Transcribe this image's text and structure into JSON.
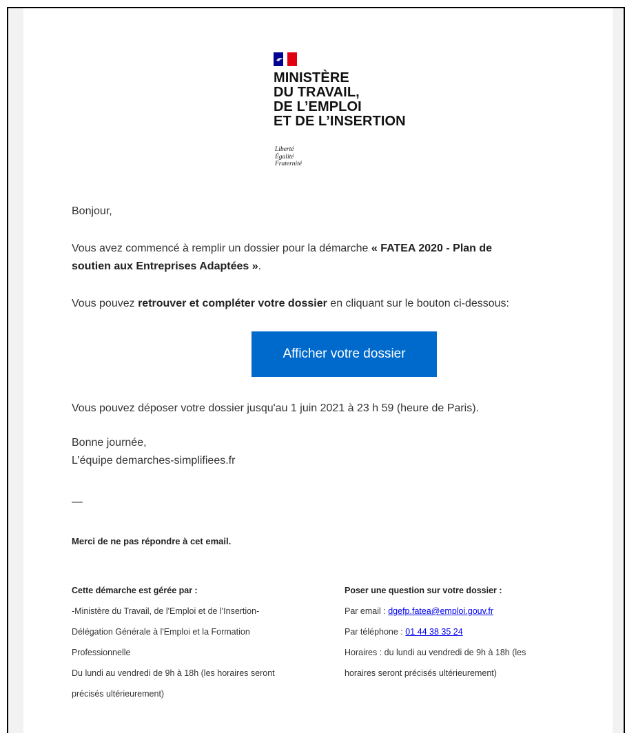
{
  "logo": {
    "ministry_lines": [
      "MINISTÈRE",
      "DU TRAVAIL,",
      "DE L’EMPLOI",
      "ET DE L’INSERTION"
    ],
    "motto_lines": [
      "Liberté",
      "Égalité",
      "Fraternité"
    ]
  },
  "email": {
    "greeting": "Bonjour,",
    "p1_prefix": "Vous avez commencé à remplir un dossier pour la démarche ",
    "p1_bold_line1": "« FATEA 2020 - Plan de",
    "p1_bold_line2": "soutien aux Entreprises Adaptées »",
    "p1_suffix": ".",
    "p2_prefix": "Vous pouvez ",
    "p2_bold": "retrouver et compléter votre dossier",
    "p2_suffix": " en cliquant sur le bouton ci-dessous:",
    "button_label": "Afficher votre dossier",
    "deadline": "Vous pouvez déposer votre dossier jusqu'au 1 juin 2021 à 23 h 59 (heure de Paris).",
    "closing": "Bonne journée,",
    "signature": "L’équipe demarches-simplifiees.fr",
    "separator": "—",
    "no_reply": "Merci de ne pas répondre à cet email."
  },
  "footer": {
    "managed_title": "Cette démarche est gérée par :",
    "managed_lines": [
      "-Ministère du Travail, de l'Emploi et de l'Insertion-",
      "Délégation Générale à l'Emploi et la Formation",
      "Professionnelle",
      "Du lundi au vendredi de 9h à 18h (les horaires seront",
      "précisés ultérieurement)"
    ],
    "question_title": "Poser une question sur votre dossier :",
    "email_label": "Par email : ",
    "email_value": "dgefp.fatea@emploi.gouv.fr",
    "phone_label": "Par téléphone : ",
    "phone_value": "01 44 38 35 24",
    "hours_lines": [
      "Horaires : du lundi au vendredi de 9h à 18h (les",
      "horaires seront précisés ultérieurement)"
    ]
  },
  "colors": {
    "button": "#0069cc",
    "flag_blue": "#000091",
    "flag_red": "#e1000f"
  }
}
